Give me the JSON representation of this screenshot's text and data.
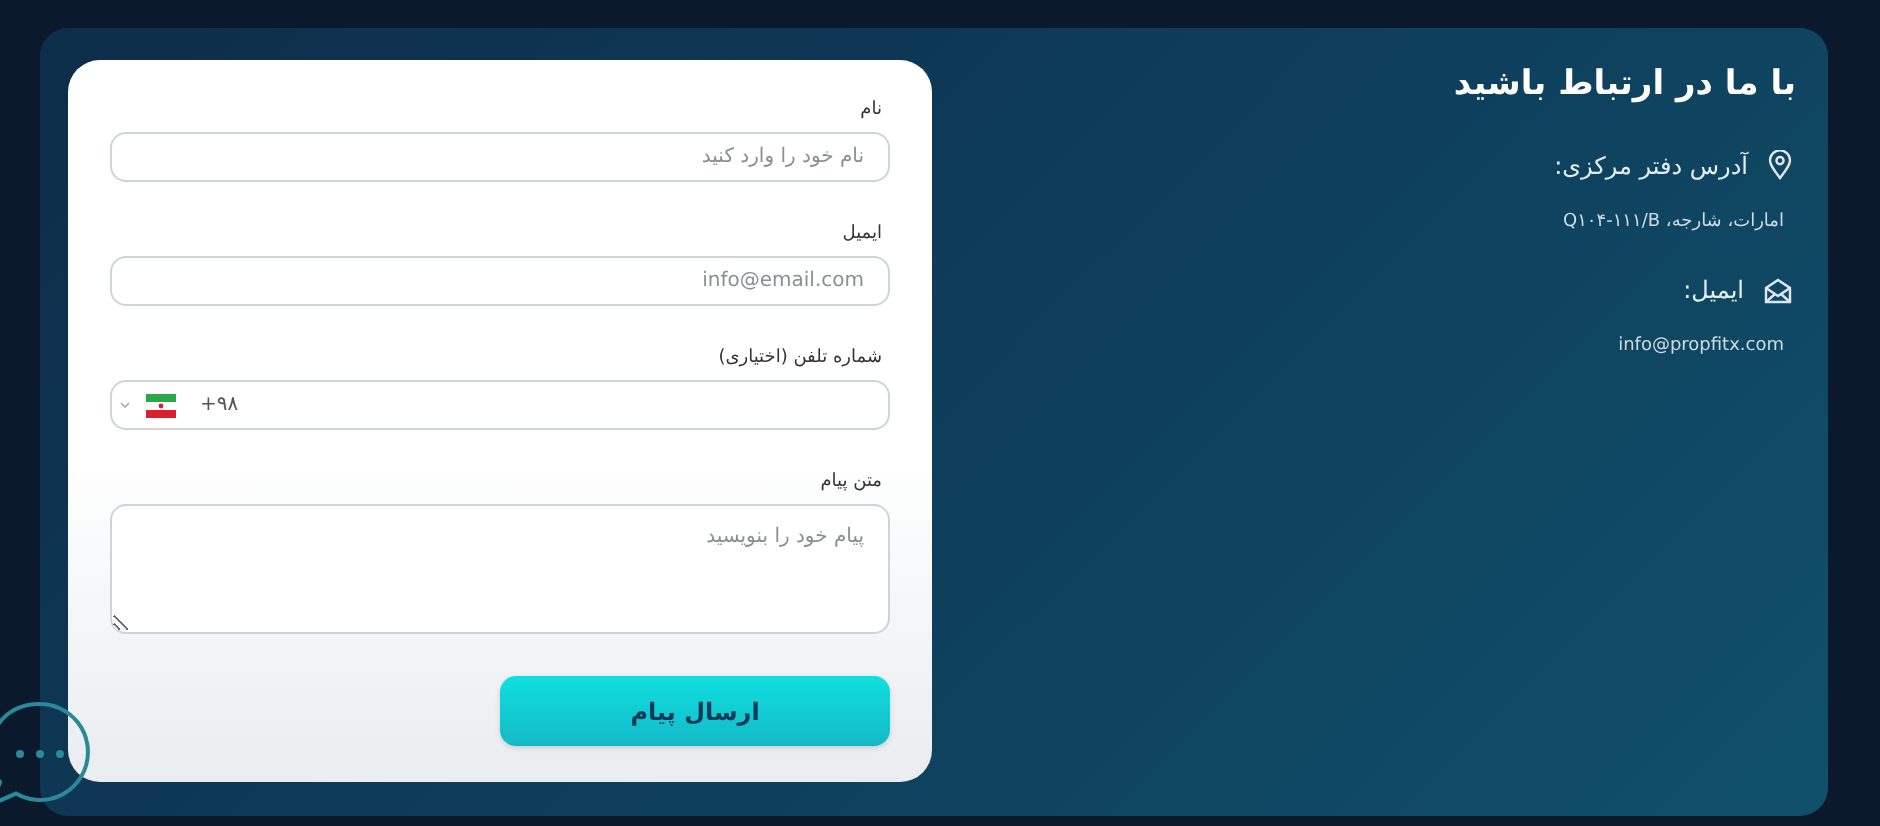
{
  "form": {
    "fields": [
      {
        "kind": "text",
        "label": "نام",
        "placeholder": "نام خود را وارد کنید"
      },
      {
        "kind": "text",
        "label": "ایمیل",
        "placeholder": "info@email.com"
      },
      {
        "kind": "phone",
        "label": "شماره تلفن (اختیاری)",
        "value": "+۹۸"
      },
      {
        "kind": "textarea",
        "label": "متن پیام",
        "placeholder": "پیام خود را بنویسید"
      }
    ],
    "submit": "ارسال پیام"
  },
  "contact": {
    "title": "با ما در ارتباط باشید",
    "items": [
      {
        "kind": "address",
        "heading": "آدرس دفتر مرکزی:",
        "value": "امارات، شارجه، Q۱۰۴-۱۱۱/B"
      },
      {
        "kind": "email",
        "heading": "ایمیل:",
        "value": "info@propfitx.com"
      }
    ]
  }
}
